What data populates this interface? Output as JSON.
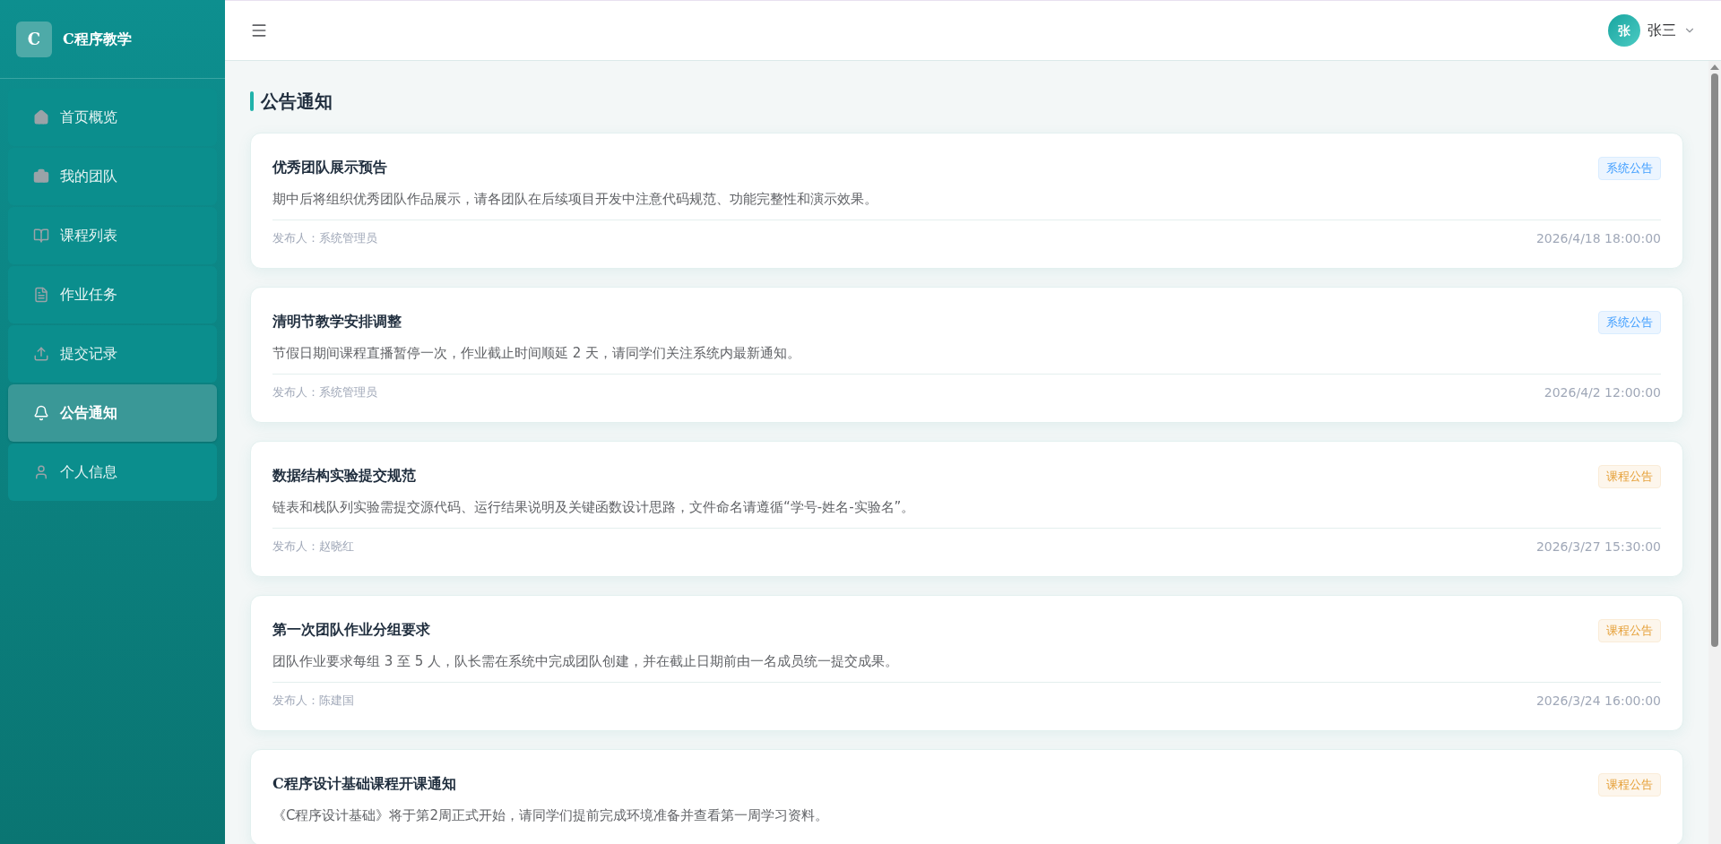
{
  "brand": {
    "logo": "C",
    "name": "C程序教学"
  },
  "sidebar": {
    "items": [
      {
        "label": "首页概览",
        "selected": false
      },
      {
        "label": "我的团队",
        "selected": false
      },
      {
        "label": "课程列表",
        "selected": false
      },
      {
        "label": "作业任务",
        "selected": false
      },
      {
        "label": "提交记录",
        "selected": false
      },
      {
        "label": "公告通知",
        "selected": true
      },
      {
        "label": "个人信息",
        "selected": false
      }
    ]
  },
  "header": {
    "user": {
      "avatar": "张",
      "name": "张三"
    }
  },
  "page_title": "公告通知",
  "notices": [
    {
      "title": "优秀团队展示预告",
      "tag": "系统公告",
      "kind": "system",
      "body": "期中后将组织优秀团队作品展示，请各团队在后续项目开发中注意代码规范、功能完整性和演示效果。",
      "publisher": "发布人：系统管理员",
      "time": "2026/4/18 18:00:00"
    },
    {
      "title": "清明节教学安排调整",
      "tag": "系统公告",
      "kind": "system",
      "body": "节假日期间课程直播暂停一次，作业截止时间顺延 2 天，请同学们关注系统内最新通知。",
      "publisher": "发布人：系统管理员",
      "time": "2026/4/2 12:00:00"
    },
    {
      "title": "数据结构实验提交规范",
      "tag": "课程公告",
      "kind": "course",
      "body": "链表和栈队列实验需提交源代码、运行结果说明及关键函数设计思路，文件命名请遵循“学号-姓名-实验名”。",
      "publisher": "发布人：赵晓红",
      "time": "2026/3/27 15:30:00"
    },
    {
      "title": "第一次团队作业分组要求",
      "tag": "课程公告",
      "kind": "course",
      "body": "团队作业要求每组 3 至 5 人，队长需在系统中完成团队创建，并在截止日期前由一名成员统一提交成果。",
      "publisher": "发布人：陈建国",
      "time": "2026/3/24 16:00:00"
    },
    {
      "title": "C程序设计基础课程开课通知",
      "tag": "课程公告",
      "kind": "course",
      "body": "《C程序设计基础》将于第2周正式开始，请同学们提前完成环境准备并查看第一周学习资料。"
    }
  ]
}
